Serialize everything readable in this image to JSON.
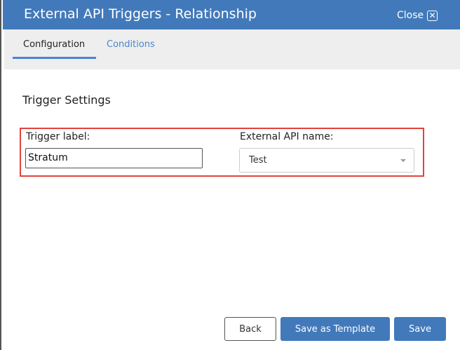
{
  "header": {
    "title": "External API Triggers - Relationship",
    "close_label": "Close",
    "close_glyph": "✕"
  },
  "tabs": [
    {
      "label": "Configuration",
      "active": true
    },
    {
      "label": "Conditions",
      "active": false
    }
  ],
  "section": {
    "title": "Trigger Settings"
  },
  "form": {
    "trigger_label": {
      "label": "Trigger label:",
      "value": "Stratum"
    },
    "api_name": {
      "label": "External API name:",
      "value": "Test"
    }
  },
  "buttons": {
    "back": "Back",
    "save_template": "Save as Template",
    "save": "Save"
  },
  "colors": {
    "header": "#4279ba",
    "highlight": "#e2433c",
    "tab_accent": "#4a86d8"
  }
}
